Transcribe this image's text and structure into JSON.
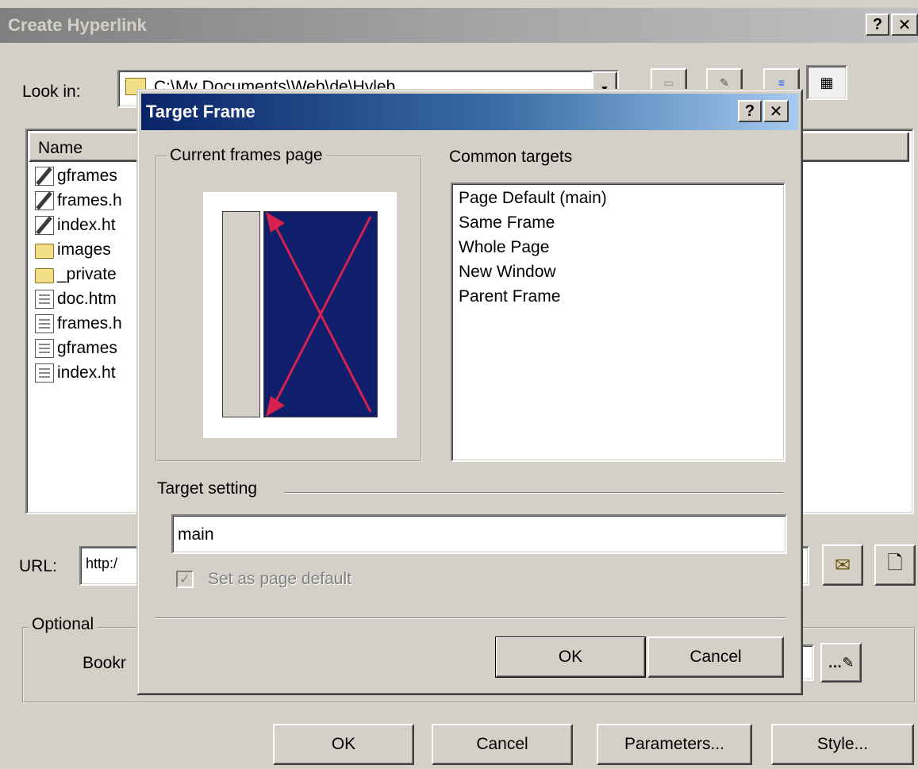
{
  "create_hyperlink": {
    "title": "Create Hyperlink",
    "help_glyph": "?",
    "close_glyph": "✕",
    "look_in_label": "Look in:",
    "look_in_value": "C:\\My Documents\\Web\\de\\Hyleb",
    "toolbar_icons": [
      "web-browse-icon",
      "edit-icon",
      "list-view-icon",
      "details-view-icon"
    ],
    "column_name": "Name",
    "files": [
      {
        "name": "gframes",
        "icon": "edit-doc-icon"
      },
      {
        "name": "frames.h",
        "icon": "edit-doc-icon"
      },
      {
        "name": "index.ht",
        "icon": "edit-doc-icon"
      },
      {
        "name": "images",
        "icon": "folder-icon"
      },
      {
        "name": "_private",
        "icon": "folder-icon"
      },
      {
        "name": "doc.htm",
        "icon": "doc-icon"
      },
      {
        "name": "frames.h",
        "icon": "doc-icon"
      },
      {
        "name": "gframes",
        "icon": "doc-icon"
      },
      {
        "name": "index.ht",
        "icon": "doc-icon"
      }
    ],
    "url_label": "URL:",
    "url_value": "http:/",
    "optional_label": "Optional",
    "bookmark_label": "Bookr",
    "ok_label": "OK",
    "cancel_label": "Cancel",
    "parameters_label": "Parameters...",
    "style_label": "Style..."
  },
  "target_frame": {
    "title": "Target Frame",
    "help_glyph": "?",
    "close_glyph": "✕",
    "current_frames_label": "Current frames page",
    "common_targets_label": "Common targets",
    "common_targets": [
      "Page Default (main)",
      "Same Frame",
      "Whole Page",
      "New Window",
      "Parent Frame"
    ],
    "target_setting_label": "Target setting",
    "target_value": "main",
    "set_default_label": "Set as page default",
    "set_default_checked": true,
    "ok_label": "OK",
    "cancel_label": "Cancel"
  },
  "colors": {
    "dialog_bg": "#d4d0c8",
    "active_title_start": "#0a246a",
    "active_title_end": "#a6caf0",
    "inactive_title": "#808080",
    "frame_selected": "#0f1f6b",
    "frame_arrow": "#d6204e"
  }
}
